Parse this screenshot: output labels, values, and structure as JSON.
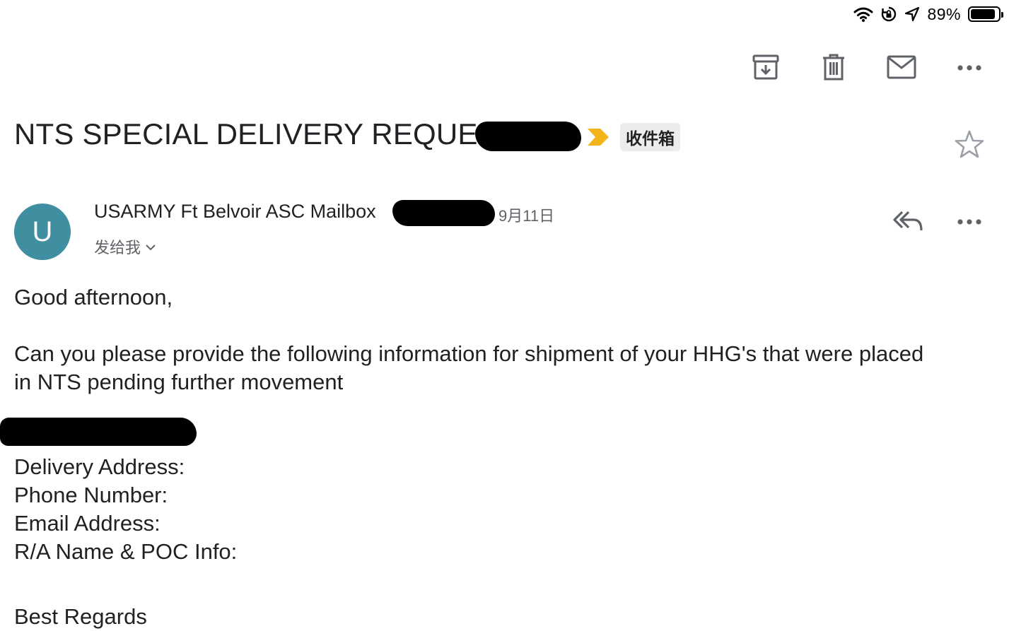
{
  "status_bar": {
    "battery_percent": "89%",
    "battery_level": 0.89
  },
  "toolbar": {
    "archive_icon": "archive-icon",
    "delete_icon": "trash-icon",
    "mark_unread_icon": "mail-icon",
    "more_icon": "more-horizontal-icon"
  },
  "subject": {
    "text": "NTS SPECIAL DELIVERY REQUEST",
    "label": "收件箱",
    "important_color": "#f2b31b"
  },
  "sender": {
    "avatar_letter": "U",
    "avatar_color": "#3f8fa0",
    "name": "USARMY Ft Belvoir ASC Mailbox",
    "date": "9月11日",
    "recipient": "发给我"
  },
  "body": {
    "greeting": "Good afternoon,",
    "paragraph": "Can you please provide the following information for shipment of your HHG's that were placed in NTS pending further movement",
    "fields": [
      "Delivery Address:",
      "Phone Number:",
      "Email Address:",
      "R/A Name & POC Info:"
    ],
    "closing": "Best Regards"
  }
}
